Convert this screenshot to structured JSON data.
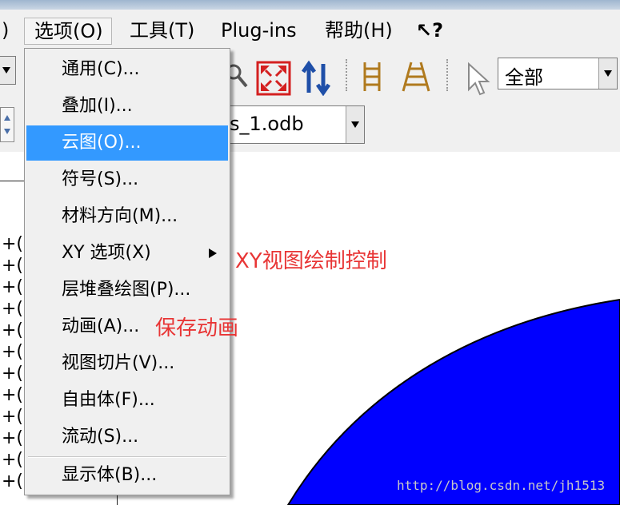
{
  "menubar": {
    "items": [
      {
        "label": ")"
      },
      {
        "label": "选项(O)",
        "active": true
      },
      {
        "label": "工具(T)"
      },
      {
        "label": "Plug-ins"
      },
      {
        "label": "帮助(H)"
      },
      {
        "label": "↖?"
      }
    ]
  },
  "toolbar": {
    "filter_value": "全部",
    "odb_value": "s_1.odb"
  },
  "dropdown": {
    "items": [
      {
        "label": "通用(C)..."
      },
      {
        "label": "叠加(I)..."
      },
      {
        "label": "云图(O)...",
        "highlighted": true
      },
      {
        "label": "符号(S)..."
      },
      {
        "label": "材料方向(M)..."
      },
      {
        "label": "XY 选项(X)",
        "submenu": true
      },
      {
        "label": "层堆叠绘图(P)..."
      },
      {
        "label": "动画(A)..."
      },
      {
        "label": "视图切片(V)..."
      },
      {
        "label": "自由体(F)..."
      },
      {
        "label": "流动(S)..."
      },
      {
        "label": "显示体(B)..."
      }
    ]
  },
  "annotations": {
    "xy_note": "XY视图绘制控制",
    "animation_note": "保存动画"
  },
  "tree": {
    "row_label": "+("
  },
  "viewport": {
    "shape_color": "#0000ff"
  },
  "watermark": "http://blog.csdn.net/jh1513",
  "colors": {
    "highlight": "#3399ff",
    "annotation": "#e83535"
  }
}
